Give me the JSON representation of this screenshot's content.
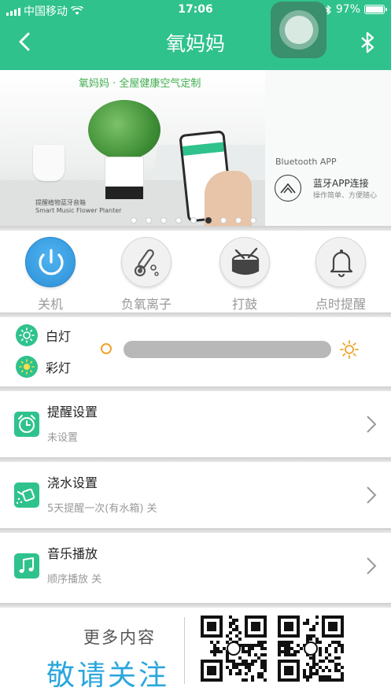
{
  "status": {
    "carrier": "中国移动",
    "time": "17:06",
    "battery": "97%"
  },
  "nav": {
    "title": "氧妈妈",
    "back_icon": "back-chevron-icon",
    "right_icon": "bluetooth-icon"
  },
  "banner": {
    "slogan": "氧妈妈 · 全屋健康空气定制",
    "product_line1": "提醒植物蓝牙音箱",
    "product_line2": "Smart Music Flower Planter",
    "bt_app": "Bluetooth APP",
    "link_title": "蓝牙APP连接",
    "link_sub": "操作简单、方便随心",
    "dots_count": 9,
    "active_dot": 5
  },
  "actions": [
    {
      "label": "关机",
      "icon": "power-icon",
      "active": true
    },
    {
      "label": "负氧离子",
      "icon": "thermometer-icon",
      "active": false
    },
    {
      "label": "打鼓",
      "icon": "drum-icon",
      "active": false
    },
    {
      "label": "点时提醒",
      "icon": "bell-icon",
      "active": false
    }
  ],
  "lights": {
    "white_label": "白灯",
    "color_label": "彩灯",
    "brightness_icon_min": "sun-outline-icon",
    "brightness_icon_max": "sun-icon"
  },
  "rows": [
    {
      "title": "提醒设置",
      "sub": "未设置",
      "icon": "alarm-clock-icon"
    },
    {
      "title": "浇水设置",
      "sub": "5天提醒一次(有水箱) 关",
      "icon": "watering-can-icon"
    },
    {
      "title": "音乐播放",
      "sub": "顺序播放 关",
      "icon": "music-note-icon"
    }
  ],
  "footer": {
    "more": "更多内容",
    "follow": "敬请关注"
  },
  "colors": {
    "brand": "#2fc28d",
    "power": "#2e8fd6",
    "follow": "#2aa6dc"
  }
}
